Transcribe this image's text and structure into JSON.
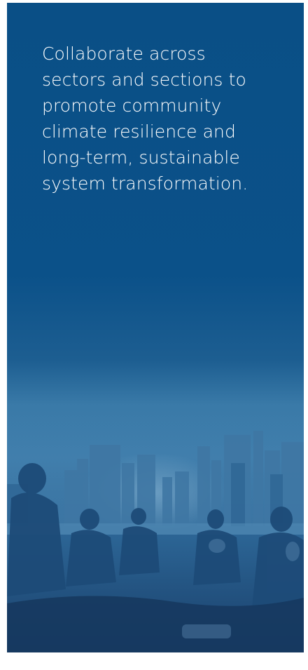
{
  "panel": {
    "text_lines": [
      "Collaborate across",
      "sectors and sections to",
      "promote community",
      "climate resilience and",
      "long-term, sustainable",
      "system transformation."
    ],
    "background_color": "#0b5189",
    "text_color": "#ffffff"
  },
  "photo": {
    "subject": "people-sitting-on-lawn-city-skyline"
  }
}
